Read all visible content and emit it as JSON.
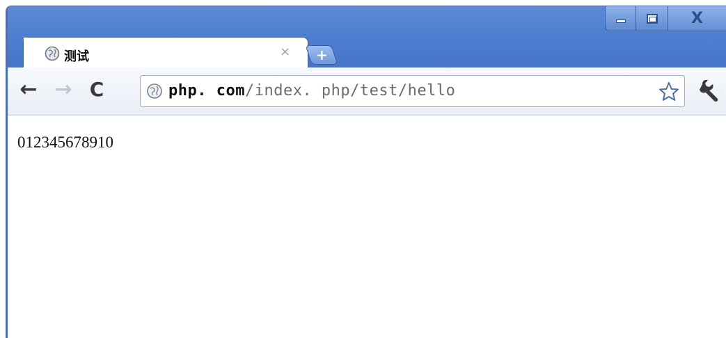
{
  "tab": {
    "title": "测试",
    "close_glyph": "×",
    "favicon": "globe-icon"
  },
  "new_tab": {
    "glyph": "+"
  },
  "window_controls": {
    "minimize": "minimize-icon",
    "maximize": "maximize-icon",
    "close_glyph": "X"
  },
  "toolbar": {
    "back_glyph": "←",
    "forward_glyph": "→",
    "reload_glyph": "C",
    "bookmark": "star-icon",
    "menu": "wrench-icon"
  },
  "omnibox": {
    "url_host": "php. com",
    "url_path": "/index. php/test/hello"
  },
  "page": {
    "body_text": "012345678910"
  },
  "colors": {
    "titlebar": "#4f7fd0",
    "url_host": "#111111",
    "url_path": "#6b6b6b",
    "forward_disabled": "#c3c8cf"
  }
}
